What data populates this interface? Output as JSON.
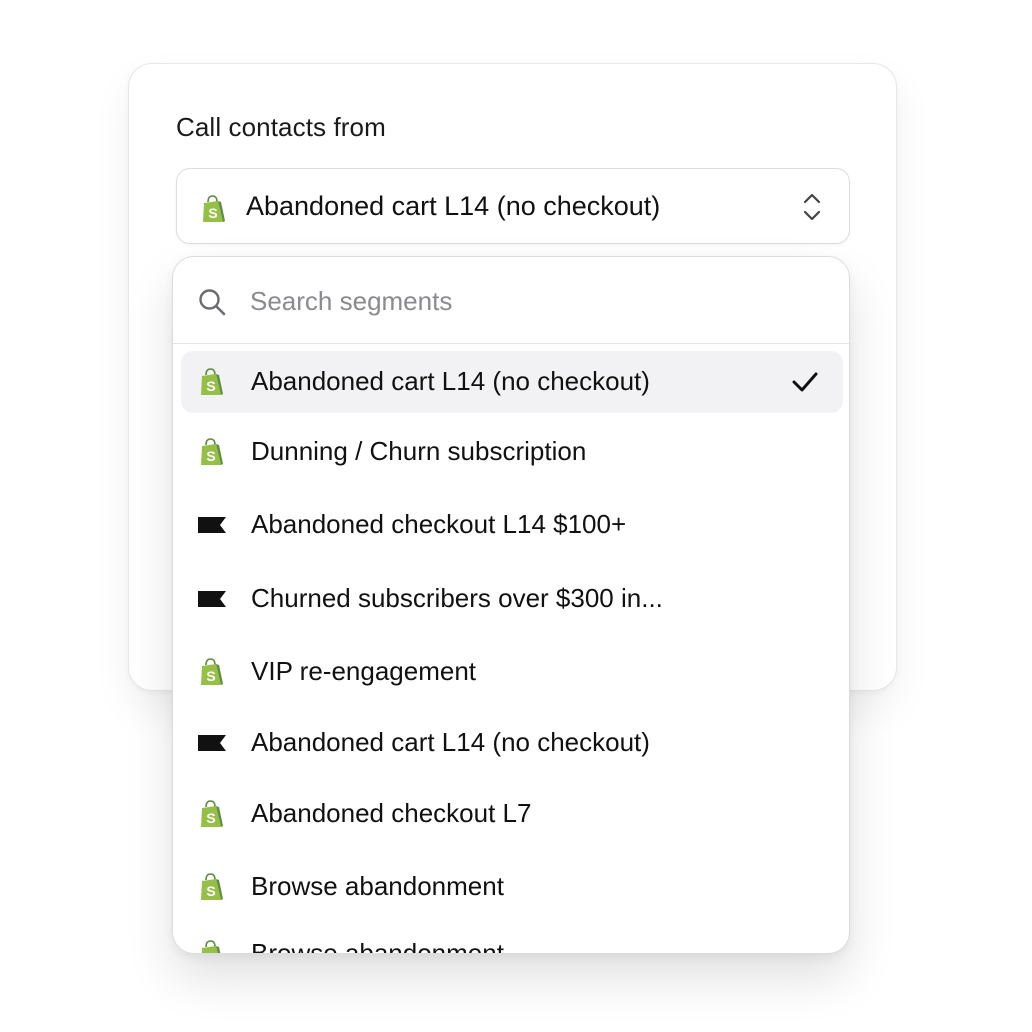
{
  "form": {
    "label": "Call contacts from",
    "selected_value": "Abandoned cart L14 (no checkout)",
    "selected_icon": "shopify-bag-icon"
  },
  "search": {
    "placeholder": "Search segments",
    "value": ""
  },
  "segments": [
    {
      "label": "Abandoned cart L14 (no checkout)",
      "icon": "shopify-bag-icon",
      "selected": true
    },
    {
      "label": "Dunning / Churn subscription",
      "icon": "shopify-bag-icon",
      "selected": false
    },
    {
      "label": "Abandoned checkout L14  $100+",
      "icon": "klaviyo-flag-icon",
      "selected": false
    },
    {
      "label": "Churned subscribers over $300 in...",
      "icon": "klaviyo-flag-icon",
      "selected": false
    },
    {
      "label": "VIP re-engagement",
      "icon": "shopify-bag-icon",
      "selected": false
    },
    {
      "label": "Abandoned cart L14 (no checkout)",
      "icon": "klaviyo-flag-icon",
      "selected": false
    },
    {
      "label": "Abandoned checkout L7",
      "icon": "shopify-bag-icon",
      "selected": false
    },
    {
      "label": "Browse abandonment",
      "icon": "shopify-bag-icon",
      "selected": false
    },
    {
      "label": "Browse abandonment",
      "icon": "shopify-bag-icon",
      "selected": false
    }
  ],
  "colors": {
    "shopify_green": "#95bf47",
    "shopify_dark_green": "#5e8e3e",
    "flag_black": "#111111",
    "selected_bg": "#f2f2f4"
  }
}
